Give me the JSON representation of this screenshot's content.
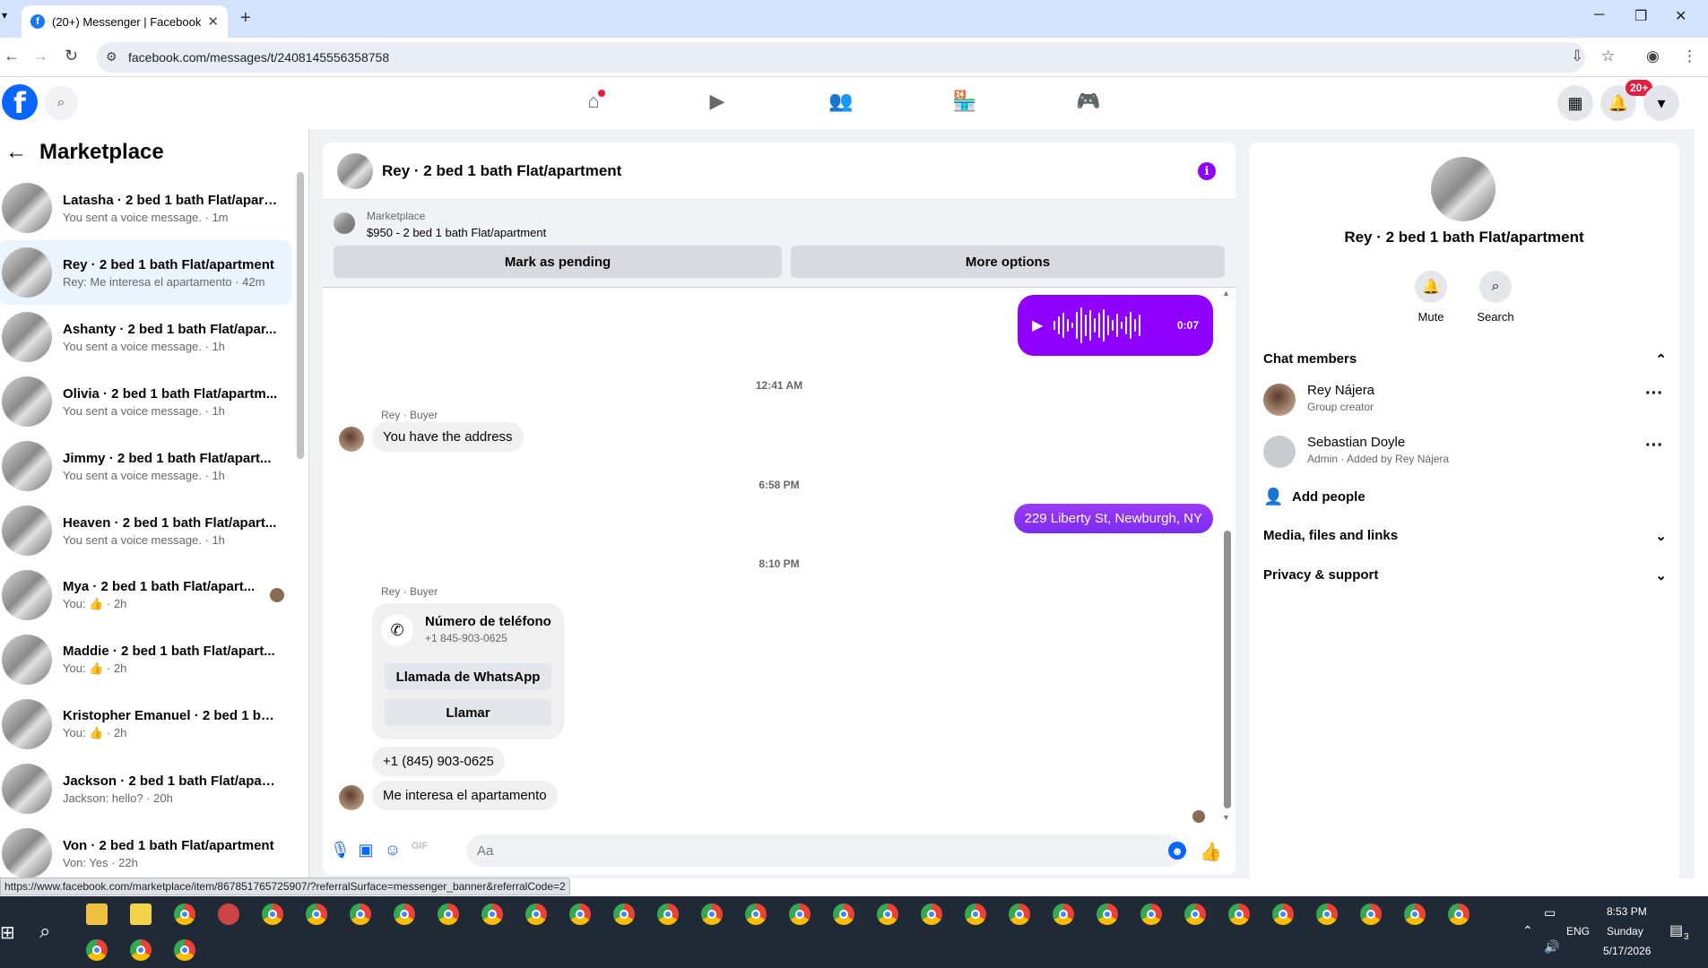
{
  "browser": {
    "tab_title": "(20+) Messenger | Facebook",
    "url": "facebook.com/messages/t/2408145556358758",
    "status_url": "https://www.facebook.com/marketplace/item/867851765725907/?referralSurface=messenger_banner&referralCode=2"
  },
  "fbnav": {
    "notif_badge": "20+"
  },
  "sidebar": {
    "title": "Marketplace",
    "conversations": [
      {
        "name": "Latasha · 2 bed 1 bath Flat/apart...",
        "sub": "You sent a voice message. · 1m"
      },
      {
        "name": "Rey · 2 bed 1 bath Flat/apartment",
        "sub": "Rey: Me interesa el apartamento · 42m"
      },
      {
        "name": "Ashanty · 2 bed 1 bath Flat/apar...",
        "sub": "You sent a voice message. · 1h"
      },
      {
        "name": "Olivia · 2 bed 1 bath Flat/apartm...",
        "sub": "You sent a voice message. · 1h"
      },
      {
        "name": "Jimmy · 2 bed 1 bath Flat/apart...",
        "sub": "You sent a voice message. · 1h"
      },
      {
        "name": "Heaven · 2 bed 1 bath Flat/apart...",
        "sub": "You sent a voice message. · 1h"
      },
      {
        "name": "Mya · 2 bed 1 bath Flat/apart...",
        "sub": "You: 👍 · 2h"
      },
      {
        "name": "Maddie · 2 bed 1 bath Flat/apart...",
        "sub": "You: 👍 · 2h"
      },
      {
        "name": "Kristopher Emanuel · 2 bed 1 bat...",
        "sub": "You: 👍 · 2h"
      },
      {
        "name": "Jackson · 2 bed 1 bath Flat/apart...",
        "sub": "Jackson: hello? · 20h"
      },
      {
        "name": "Von · 2 bed 1 bath Flat/apartment",
        "sub": "Von: Yes · 22h"
      }
    ]
  },
  "chat": {
    "title": "Rey · 2 bed 1 bath Flat/apartment",
    "banner": {
      "label": "Marketplace",
      "listing": "$950 - 2 bed 1 bath Flat/apartment",
      "mark_pending": "Mark as pending",
      "more_options": "More options"
    },
    "voice_duration": "0:07",
    "time1": "12:41 AM",
    "sender1": "Rey · Buyer",
    "msg1": "You have the address",
    "time2": "6:58 PM",
    "out_msg": "229 Liberty St, Newburgh, NY",
    "time3": "8:10 PM",
    "sender2": "Rey · Buyer",
    "card": {
      "title": "Número de teléfono",
      "number": "+1 845-903-0625",
      "btn1": "Llamada de WhatsApp",
      "btn2": "Llamar"
    },
    "msg2": "+1 (845) 903-0625",
    "msg3": "Me interesa el apartamento",
    "composer_placeholder": "Aa"
  },
  "info": {
    "name": "Rey · 2 bed 1 bath Flat/apartment",
    "mute": "Mute",
    "search": "Search",
    "chat_members": "Chat members",
    "members": [
      {
        "name": "Rey Nájera",
        "sub": "Group creator"
      },
      {
        "name": "Sebastian Doyle",
        "sub": "Admin · Added by Rey Nájera"
      }
    ],
    "add_people": "Add people",
    "media": "Media, files and links",
    "privacy": "Privacy & support"
  },
  "taskbar": {
    "time": "8:53 PM",
    "day": "Sunday",
    "date": "5/17/2026",
    "lang": "ENG",
    "notif_count": "3"
  }
}
